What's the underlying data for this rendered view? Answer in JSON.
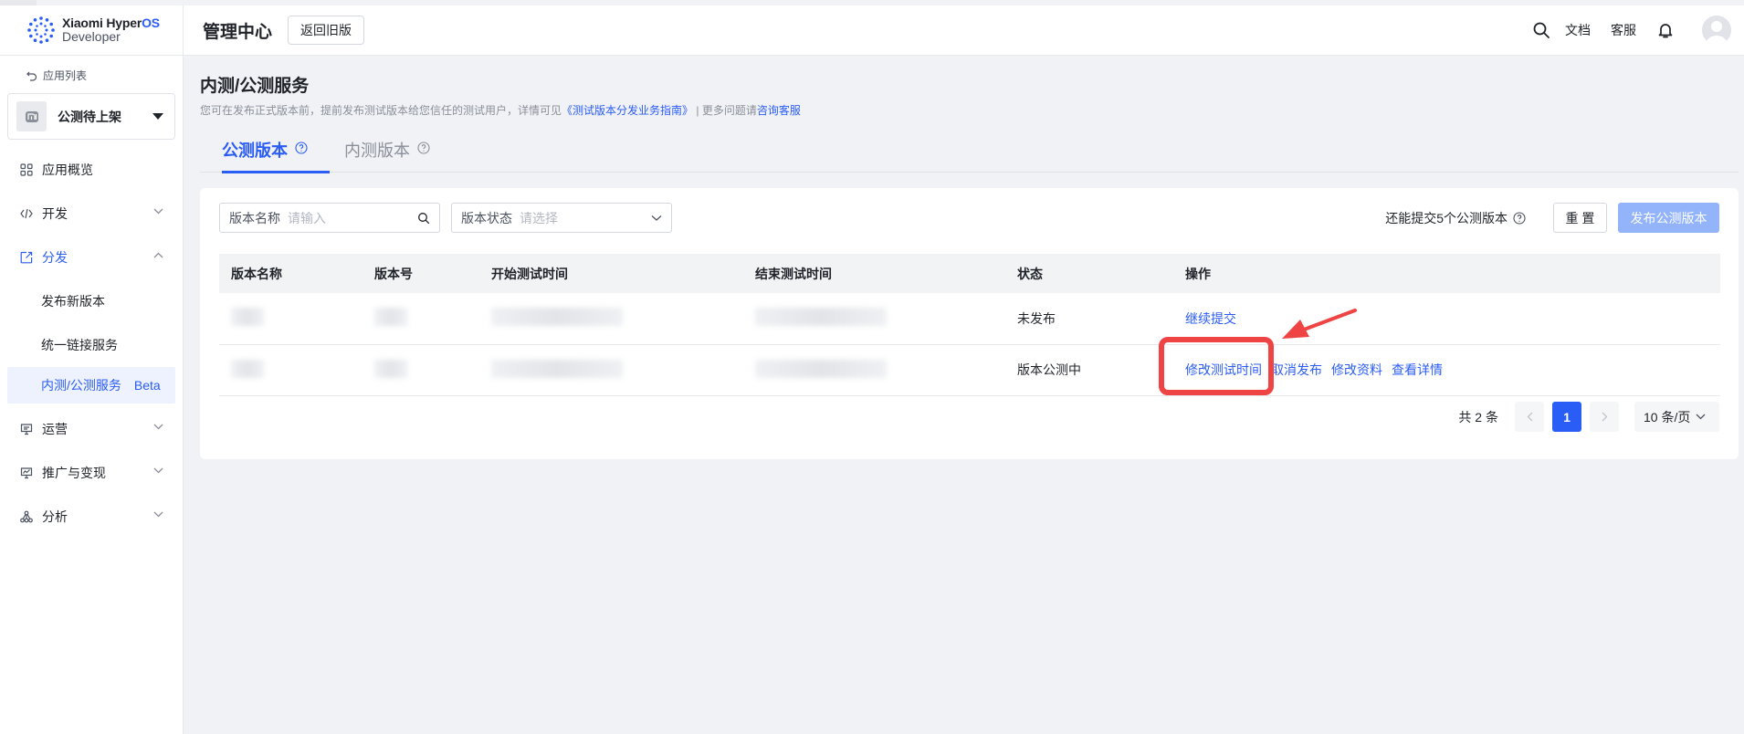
{
  "header": {
    "brand_line1": "Xiaomi Hyper",
    "brand_line1_accent": "OS",
    "brand_line2": "Developer",
    "console_title": "管理中心",
    "back_old_label": "返回旧版",
    "docs_label": "文档",
    "support_label": "客服"
  },
  "sidebar": {
    "back_apps": "应用列表",
    "app_name": "公测待上架",
    "items": [
      {
        "label": "应用概览"
      },
      {
        "label": "开发"
      },
      {
        "label": "分发"
      },
      {
        "label": "运营"
      },
      {
        "label": "推广与变现"
      },
      {
        "label": "分析"
      }
    ],
    "sub_items": [
      {
        "label": "发布新版本"
      },
      {
        "label": "统一链接服务"
      },
      {
        "label": "内测/公测服务",
        "badge": "Beta"
      }
    ]
  },
  "main": {
    "title": "内测/公测服务",
    "desc_prefix": "您可在发布正式版本前，提前发布测试版本给您信任的测试用户，详情可见",
    "desc_link": "《测试版本分发业务指南》",
    "desc_middle": "| 更多问题请",
    "desc_link2": "咨询客服",
    "tabs": [
      {
        "label": "公测版本"
      },
      {
        "label": "内测版本"
      }
    ],
    "filters": {
      "name_label": "版本名称",
      "name_placeholder": "请输入",
      "status_label": "版本状态",
      "status_placeholder": "请选择"
    },
    "remaining_text": "还能提交5个公测版本",
    "reset_label": "重 置",
    "publish_label": "发布公测版本",
    "table": {
      "headers": [
        "版本名称",
        "版本号",
        "开始测试时间",
        "结束测试时间",
        "状态",
        "操作"
      ],
      "rows": [
        {
          "status": "未发布",
          "ops": [
            "继续提交"
          ]
        },
        {
          "status": "版本公测中",
          "ops": [
            "修改测试时间",
            "取消发布",
            "修改资料",
            "查看详情"
          ]
        }
      ]
    },
    "pagination": {
      "total": "共 2 条",
      "current": "1",
      "page_size": "10 条/页"
    }
  },
  "colors": {
    "accent": "#2a5cf6",
    "annotation": "#ef4444",
    "publish_disabled": "#93b4fb"
  }
}
